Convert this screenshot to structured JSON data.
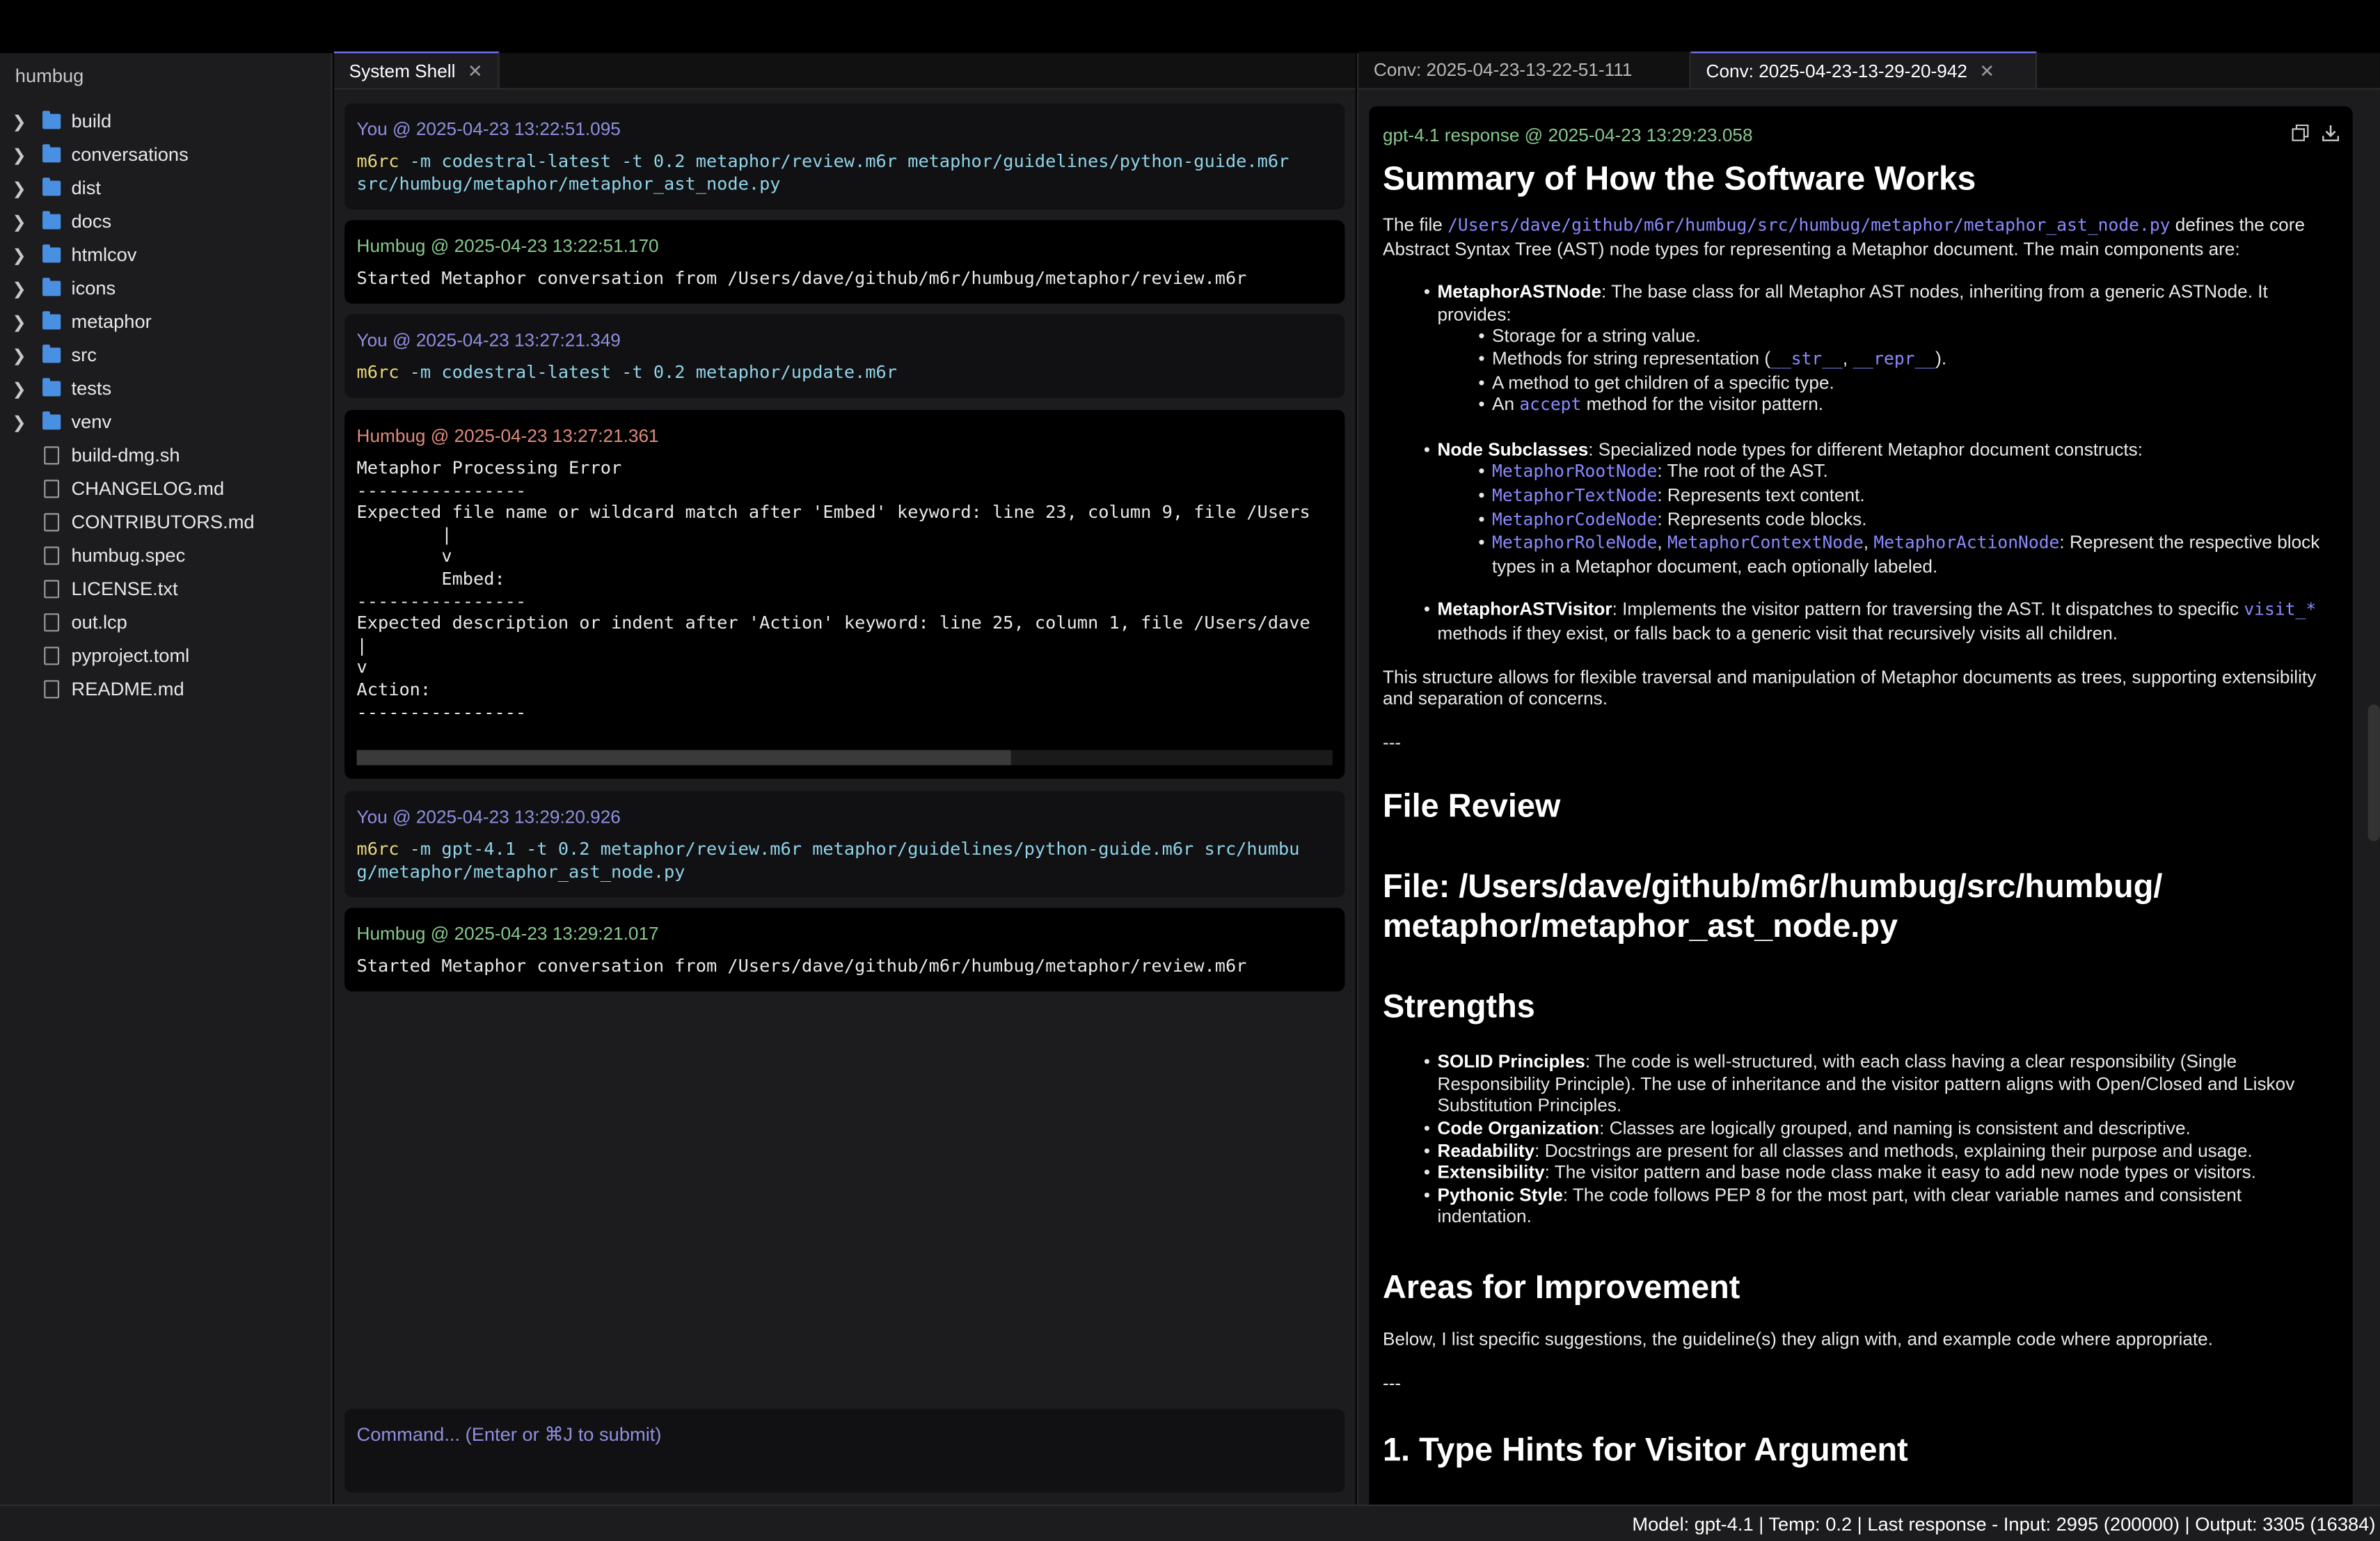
{
  "sidebar": {
    "root": "humbug",
    "folders": [
      "build",
      "conversations",
      "dist",
      "docs",
      "htmlcov",
      "icons",
      "metaphor",
      "src",
      "tests",
      "venv"
    ],
    "files": [
      "build-dmg.sh",
      "CHANGELOG.md",
      "CONTRIBUTORS.md",
      "humbug.spec",
      "LICENSE.txt",
      "out.lcp",
      "pyproject.toml",
      "README.md"
    ]
  },
  "shell": {
    "tab": "System Shell",
    "messages": [
      {
        "head": "You @ 2025-04-23 13:22:51.095",
        "cmd_w1": "m6rc",
        "cmd_rest": " -m codestral-latest -t 0.2 metaphor/review.m6r metaphor/guidelines/python-guide.m6r",
        "line2": "src/humbug/metaphor/metaphor_ast_node.py"
      },
      {
        "head": "Humbug @ 2025-04-23 13:22:51.170",
        "text": "Started Metaphor conversation from /Users/dave/github/m6r/humbug/metaphor/review.m6r"
      },
      {
        "head": "You @ 2025-04-23 13:27:21.349",
        "cmd_w1": "m6rc",
        "cmd_rest": " -m codestral-latest -t 0.2 metaphor/update.m6r"
      },
      {
        "head": "Humbug @ 2025-04-23 13:27:21.361",
        "text": "Metaphor Processing Error\n----------------\nExpected file name or wildcard match after 'Embed' keyword: line 23, column 9, file /Users\n        |\n        v\n        Embed:\n----------------\nExpected description or indent after 'Action' keyword: line 25, column 1, file /Users/dave\n|\nv\nAction:\n----------------"
      },
      {
        "head": "You @ 2025-04-23 13:29:20.926",
        "cmd_w1": "m6rc",
        "cmd_rest": " -m gpt-4.1 -t 0.2 metaphor/review.m6r metaphor/guidelines/python-guide.m6r src/humbu",
        "line2": "g/metaphor/metaphor_ast_node.py"
      },
      {
        "head": "Humbug @ 2025-04-23 13:29:21.017",
        "text": "Started Metaphor conversation from /Users/dave/github/m6r/humbug/metaphor/review.m6r"
      }
    ],
    "scroll_fraction": 0.67,
    "command_placeholder": "Command... (Enter or ⌘J to submit)"
  },
  "conv": {
    "tabs": [
      "Conv: 2025-04-23-13-22-51-111",
      "Conv: 2025-04-23-13-29-20-942"
    ],
    "response_head": "gpt-4.1 response @ 2025-04-23 13:29:23.058",
    "h_summary": "Summary of How the Software Works",
    "p1_pre": "The file ",
    "p1_link": "/Users/dave/github/m6r/humbug/src/humbug/metaphor/metaphor_ast_node.py",
    "p1_post": " defines the core Abstract Syntax Tree (AST) node types for representing a Metaphor document. The main components are:",
    "b1_title": "MetaphorASTNode",
    "b1_text": ": The base class for all Metaphor AST nodes, inheriting from a generic ASTNode. It provides:",
    "b1_sub1": "Storage for a string value.",
    "b1_sub2_pre": "Methods for string representation (",
    "b1_sub2_c1": "__str__",
    "b1_sub2_sep": ", ",
    "b1_sub2_c2": "__repr__",
    "b1_sub2_post": ").",
    "b1_sub3": "A method to get children of a specific type.",
    "b1_sub4_pre": "An ",
    "b1_sub4_code": "accept",
    "b1_sub4_post": " method for the visitor pattern.",
    "b2_title": "Node Subclasses",
    "b2_text": ": Specialized node types for different Metaphor document constructs:",
    "b2_s1_code": "MetaphorRootNode",
    "b2_s1_text": ": The root of the AST.",
    "b2_s2_code": "MetaphorTextNode",
    "b2_s2_text": ": Represents text content.",
    "b2_s3_code": "MetaphorCodeNode",
    "b2_s3_text": ": Represents code blocks.",
    "b2_s4_c1": "MetaphorRoleNode",
    "b2_s4_c2": "MetaphorContextNode",
    "b2_s4_c3": "MetaphorActionNode",
    "b2_s4_sep": ", ",
    "b2_s4_text": ": Represent the respective block types in a Metaphor document, each optionally labeled.",
    "b3_title": "MetaphorASTVisitor",
    "b3_text": ": Implements the visitor pattern for traversing the AST. It dispatches to specific ",
    "b3_code": "visit_*",
    "b3_post": " methods if they exist, or falls back to a generic visit that recursively visits all children.",
    "p2": "This structure allows for flexible traversal and manipulation of Metaphor documents as trees, supporting extensibility and separation of concerns.",
    "hr1": "---",
    "h_file_review": "File Review",
    "h_file": "File: /Users/dave/github/m6r/humbug/src/humbug/\nmetaphor/metaphor_ast_node.py",
    "h_strengths": "Strengths",
    "strengths": [
      {
        "title": "SOLID Principles",
        "text": ": The code is well-structured, with each class having a clear responsibility (Single Responsibility Principle). The use of inheritance and the visitor pattern aligns with Open/Closed and Liskov Substitution Principles."
      },
      {
        "title": "Code Organization",
        "text": ": Classes are logically grouped, and naming is consistent and descriptive."
      },
      {
        "title": "Readability",
        "text": ": Docstrings are present for all classes and methods, explaining their purpose and usage."
      },
      {
        "title": "Extensibility",
        "text": ": The visitor pattern and base node class make it easy to add new node types or visitors."
      },
      {
        "title": "Pythonic Style",
        "text": ": The code follows PEP 8 for the most part, with clear variable names and consistent indentation."
      }
    ],
    "h_areas": "Areas for Improvement",
    "p3": "Below, I list specific suggestions, the guideline(s) they align with, and example code where appropriate.",
    "hr2": "---",
    "h_type_hints": "1. Type Hints for Visitor Argument"
  },
  "status": "Model: gpt-4.1 | Temp: 0.2 | Last response - Input: 2995 (200000) | Output: 3305 (16384)"
}
